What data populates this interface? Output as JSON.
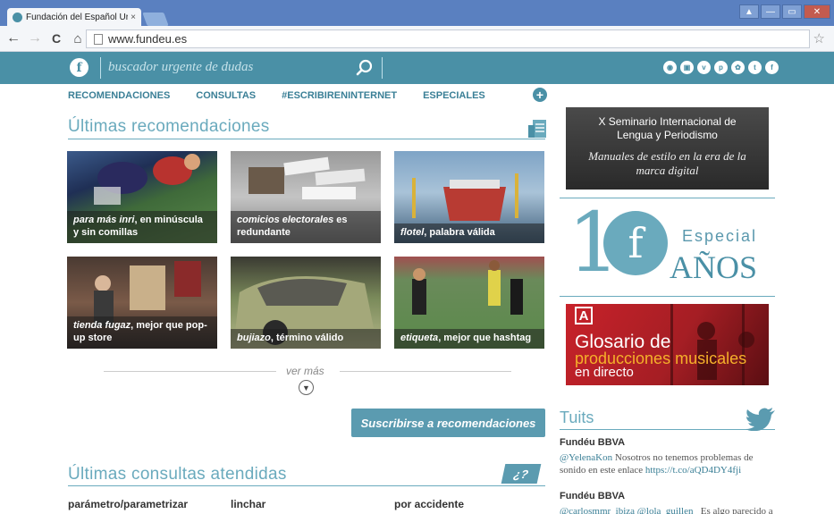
{
  "browser": {
    "tab_title": "Fundación del Español Urgen",
    "tab_close": "×",
    "url": "www.fundeu.es",
    "back": "←",
    "forward": "→",
    "reload": "C",
    "home": "⌂",
    "star": "☆",
    "win_user": "▲",
    "win_min": "—",
    "win_max": "▭",
    "win_close": "✕"
  },
  "site": {
    "logo_letter": "f",
    "search_placeholder": "buscador urgente de dudas",
    "accent_color": "#4a90a6",
    "social_icons": [
      "rss-icon",
      "instagram-icon",
      "vimeo-icon",
      "pinterest-icon",
      "flickr-icon",
      "twitter-icon",
      "facebook-icon"
    ]
  },
  "nav": {
    "items": [
      "RECOMENDACIONES",
      "CONSULTAS",
      "#ESCRIBIRENINTERNET",
      "ESPECIALES"
    ],
    "plus": "+"
  },
  "recomendaciones": {
    "title": "Últimas recomendaciones",
    "tiles": [
      {
        "em": "para más inri",
        "rest": ", en minúscula y sin comillas"
      },
      {
        "em": "comicios electorales",
        "rest": " es redundante"
      },
      {
        "em": "flotel",
        "rest": ", palabra válida"
      },
      {
        "em": "tienda fugaz",
        "rest": ", mejor que pop-up store"
      },
      {
        "em": "bujiazo",
        "rest": ", término válido"
      },
      {
        "em": "etiqueta",
        "rest": ", mejor que hashtag"
      }
    ],
    "ver_mas": "ver más",
    "subscribe": "Suscribirse a recomendaciones"
  },
  "consultas": {
    "title": "Últimas consultas atendidas",
    "icon_text": "¿?",
    "items": [
      "parámetro/parametrizar",
      "linchar",
      "por accidente"
    ]
  },
  "sidebar": {
    "seminario": {
      "line1": "X Seminario Internacional de",
      "line2": "Lengua y Periodismo",
      "line3": "Manuales de estilo en la era de la",
      "line4": "marca digital"
    },
    "especial": {
      "num": "1",
      "logo_letter": "f",
      "label": "Especial",
      "years": "AÑOS"
    },
    "glosario": {
      "letter": "A",
      "line1": "Glosario de",
      "line2": "producciones musicales",
      "line3": "en directo"
    },
    "tuits_title": "Tuits",
    "tweets": [
      {
        "author": "Fundéu BBVA",
        "mention": "@YelenaKon",
        "text": " Nosotros no tenemos problemas de sonido en este enlace ",
        "link": "https://t.co/aQD4DY4fji"
      },
      {
        "author": "Fundéu BBVA",
        "mention": "@carlosmmr_ibiza @lola_guillen_",
        "text": " Es algo parecido a",
        "link": ""
      }
    ]
  }
}
